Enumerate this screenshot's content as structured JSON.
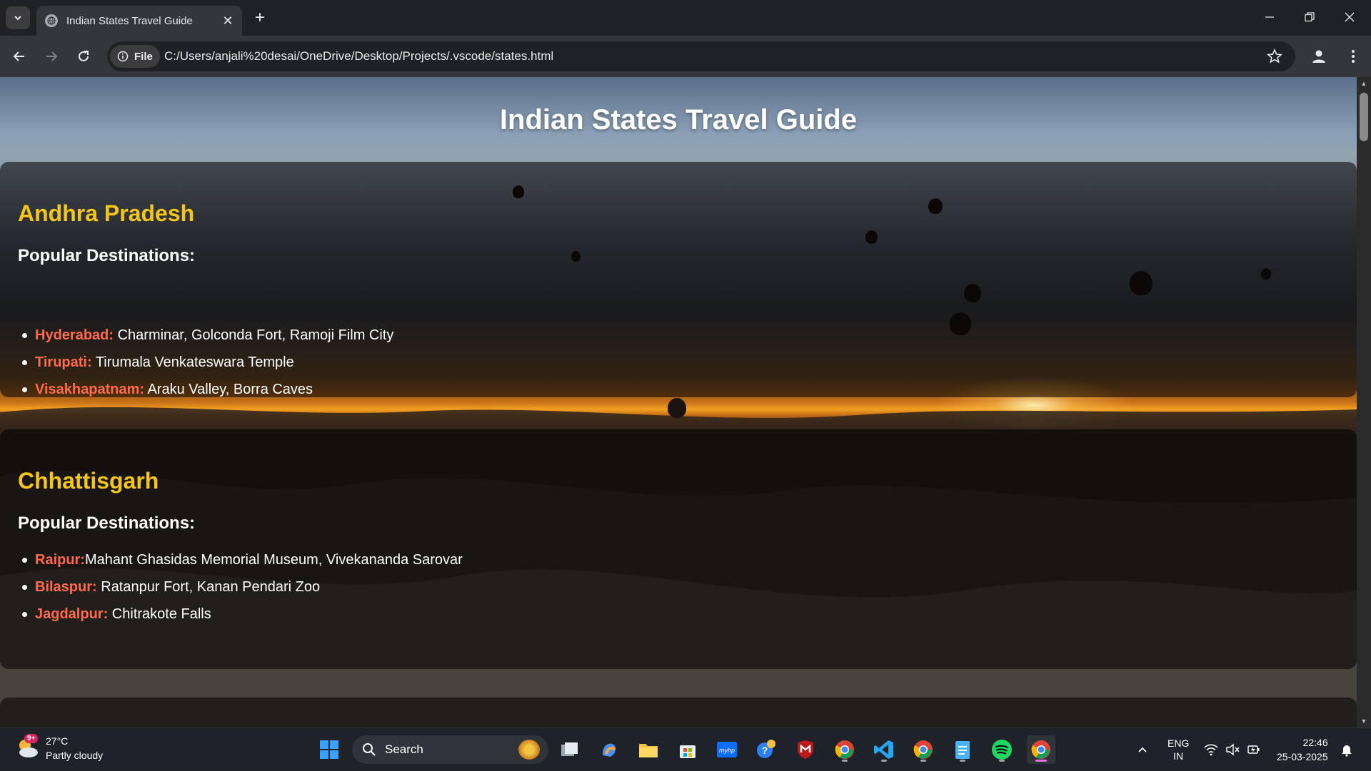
{
  "browser": {
    "tab_title": "Indian States Travel Guide",
    "file_chip": "File",
    "url": "C:/Users/anjali%20desai/OneDrive/Desktop/Projects/.vscode/states.html"
  },
  "page": {
    "title": "Indian States Travel Guide",
    "states": [
      {
        "name": "Andhra Pradesh",
        "heading": "Popular Destinations:",
        "destinations": [
          {
            "city": "Hyderabad:",
            "places": " Charminar, Golconda Fort, Ramoji Film City"
          },
          {
            "city": "Tirupati:",
            "places": " Tirumala Venkateswara Temple"
          },
          {
            "city": "Visakhapatnam:",
            "places": " Araku Valley, Borra Caves"
          }
        ]
      },
      {
        "name": "Chhattisgarh",
        "heading": "Popular Destinations:",
        "destinations": [
          {
            "city": "Raipur:",
            "places": "Mahant Ghasidas Memorial Museum, Vivekananda Sarovar"
          },
          {
            "city": "Bilaspur:",
            "places": " Ratanpur Fort, Kanan Pendari Zoo"
          },
          {
            "city": "Jagdalpur:",
            "places": " Chitrakote Falls"
          }
        ]
      }
    ]
  },
  "taskbar": {
    "weather_temp": "27°C",
    "weather_desc": "Partly cloudy",
    "weather_badge": "9+",
    "search_label": "Search",
    "lang_top": "ENG",
    "lang_bottom": "IN",
    "time": "22:46",
    "date": "25-03-2025"
  },
  "colors": {
    "state_name": "#f5c518",
    "city": "#ff6a4d",
    "card_bg": "rgba(0,0,0,0.55)"
  }
}
